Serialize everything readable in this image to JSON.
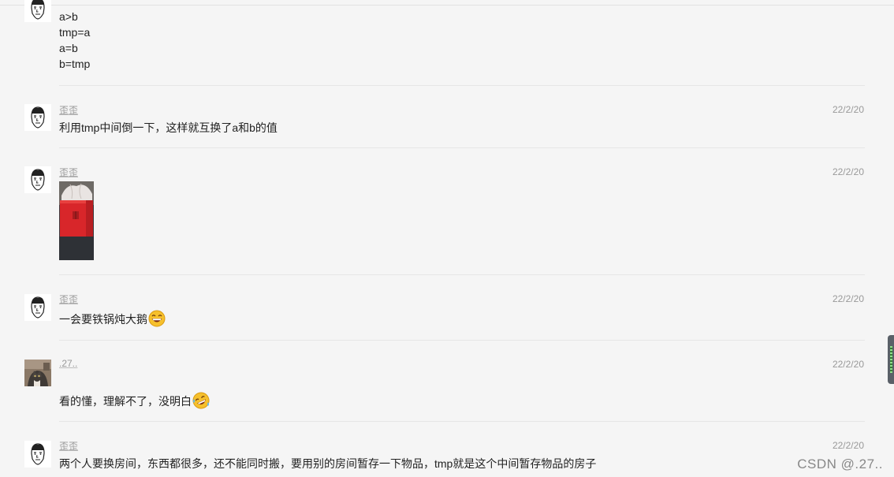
{
  "messages": [
    {
      "id": "m0",
      "lines": [
        "a>b",
        "tmp=a",
        "a=b",
        "b=tmp"
      ]
    },
    {
      "id": "m1",
      "author": "歪歪",
      "time": "22/2/20",
      "text": "利用tmp中间倒一下，这样就互换了a和b的值"
    },
    {
      "id": "m2",
      "author": "歪歪",
      "time": "22/2/20",
      "image": "red-gift-bag-photo"
    },
    {
      "id": "m3",
      "author": "歪歪",
      "time": "22/2/20",
      "text": "一会要铁锅炖大鹅",
      "emoji": "grin-emoji"
    },
    {
      "id": "m4",
      "author": ".27..",
      "time": "22/2/20",
      "text": "看的懂，理解不了，没明白",
      "emoji": "rofl-emoji"
    },
    {
      "id": "m5",
      "author": "歪歪",
      "time": "22/2/20",
      "text": "两个人要换房间，东西都很多，还不能同时搬，要用别的房间暂存一下物品，tmp就是这个中间暂存物品的房子"
    }
  ],
  "watermark": "CSDN @.27..",
  "colors": {
    "background": "#f5f5f5",
    "meta_text": "#999999",
    "body_text": "#222222",
    "divider": "#e6e6e6",
    "photo_red": "#d8262a"
  }
}
